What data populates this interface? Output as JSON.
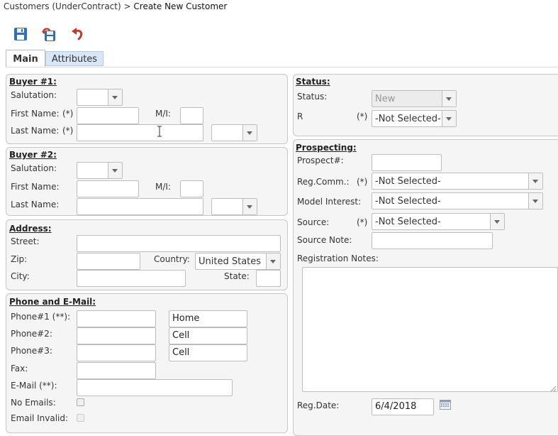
{
  "breadcrumb": {
    "parent": "Customers (UnderContract)",
    "separator": ">",
    "current": "Create New Customer"
  },
  "toolbar": {
    "save_icon": "save-icon",
    "save_close_icon": "save-close-icon",
    "undo_icon": "undo-icon"
  },
  "tabs": [
    {
      "label": "Main",
      "active": true
    },
    {
      "label": "Attributes",
      "active": false
    }
  ],
  "buyer1": {
    "title": "Buyer #1:",
    "salutation_label": "Salutation:",
    "first_name_label": "First Name:",
    "first_name_req": "(*)",
    "mi_label": "M/I:",
    "last_name_label": "Last Name:",
    "last_name_req": "(*)"
  },
  "buyer2": {
    "title": "Buyer #2:",
    "salutation_label": "Salutation:",
    "first_name_label": "First Name:",
    "mi_label": "M/I:",
    "last_name_label": "Last Name:"
  },
  "address": {
    "title": "Address:",
    "street_label": "Street:",
    "zip_label": "Zip:",
    "country_label": "Country:",
    "country_value": "United States",
    "city_label": "City:",
    "state_label": "State:"
  },
  "phone": {
    "title": "Phone and E-Mail:",
    "phone1_label": "Phone#1 (**):",
    "phone2_label": "Phone#2:",
    "phone3_label": "Phone#3:",
    "fax_label": "Fax:",
    "email_label": "E-Mail (**):",
    "no_emails_label": "No Emails:",
    "email_invalid_label": "Email Invalid:",
    "phone1_type": "Home",
    "phone2_type": "Cell",
    "phone3_type": "Cell"
  },
  "status": {
    "title": "Status:",
    "status_label": "Status:",
    "status_value": "New",
    "r_label": "R",
    "r_req": "(*)",
    "r_value": "-Not Selected-"
  },
  "prospecting": {
    "title": "Prospecting:",
    "prospect_label": "Prospect#:",
    "reg_comm_label": "Reg.Comm.:",
    "reg_comm_req": "(*)",
    "reg_comm_value": "-Not Selected-",
    "model_interest_label": "Model Interest:",
    "model_interest_value": "-Not Selected-",
    "source_label": "Source:",
    "source_req": "(*)",
    "source_value": "-Not Selected-",
    "source_note_label": "Source Note:",
    "registration_notes_label": "Registration Notes:",
    "reg_date_label": "Reg.Date:",
    "reg_date_value": "6/4/2018"
  }
}
